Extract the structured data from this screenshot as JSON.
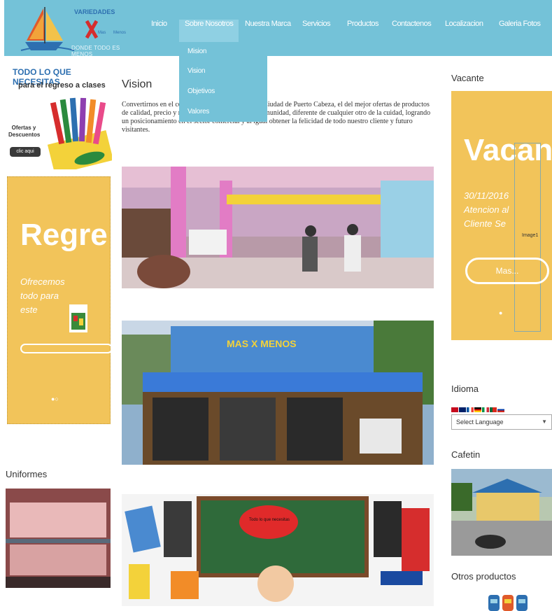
{
  "header": {
    "logo_title": "VARIEDADES",
    "logo_mid1": "Mas",
    "logo_mid2": "Menos",
    "logo_slogan": "DONDE TODO ES MENOS",
    "nav": [
      "Inicio",
      "Sobre Nosotros",
      "Nuestra Marca",
      "Servicios",
      "Productos",
      "Contactenos",
      "Localizacion",
      "Galeria Fotos"
    ],
    "dropdown": [
      "Mision",
      "Vision",
      "Objetivos",
      "Valores"
    ]
  },
  "left": {
    "promo_line1": "TODO LO QUE NECESITAS",
    "promo_line2": "para el regreso a clases",
    "promo_line3": "Ofertas y Descuentos",
    "promo_button": "clic aqui",
    "slider_big": "Regre",
    "slider_desc": [
      "Ofrecemos",
      "todo para",
      "este"
    ],
    "uniformes": "Uniformes"
  },
  "main": {
    "title": "Vision",
    "text": "Convertirnos en el comercio mas importante de la Ciudad de Puerto Cabeza, el del mejor ofertas de productos de calidad, precio y referencia comercial para la comunidad, diferente de cualquier otro de la cuidad, logrando un posicionamiento en el sector comercial y al igual obtener la felicidad de todo nuestro cliente y futuro visitantes.",
    "store_sign": "MAS X MENOS",
    "board_text": "Todo lo que necesitas"
  },
  "right": {
    "vacante_label": "Vacante",
    "slider_big": "Vacan",
    "slider_desc": [
      "30/11/2016",
      "Atencion al",
      "Cliente Se"
    ],
    "image_label": "Image1",
    "more_button": "Mas...",
    "idioma_label": "Idioma",
    "select_language": "Select Language",
    "cafetin_label": "Cafetin",
    "otros_label": "Otros productos"
  },
  "colors": {
    "header_bg": "#74c2d8",
    "slider_bg": "#f2c45a",
    "accent_blue": "#2d6fb0"
  }
}
